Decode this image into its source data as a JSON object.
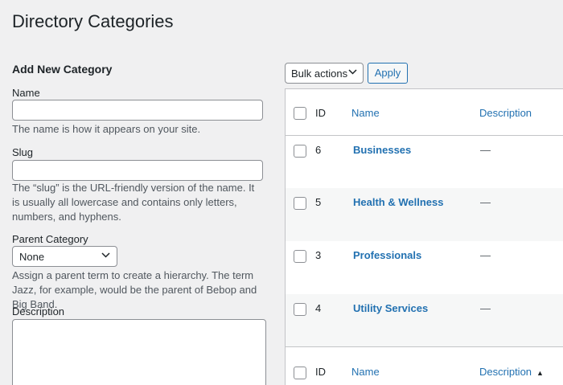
{
  "page": {
    "title": "Directory Categories"
  },
  "form": {
    "heading": "Add New Category",
    "name": {
      "label": "Name",
      "value": "",
      "help": "The name is how it appears on your site."
    },
    "slug": {
      "label": "Slug",
      "value": "",
      "help": "The “slug” is the URL-friendly version of the name. It is usually all lowercase and contains only letters, numbers, and hyphens."
    },
    "parent": {
      "label": "Parent Category",
      "selected": "None",
      "help": "Assign a parent term to create a hierarchy. The term Jazz, for example, would be the parent of Bebop and Big Band."
    },
    "description": {
      "label": "Description",
      "value": ""
    }
  },
  "toolbar": {
    "bulk_selected": "Bulk actions",
    "apply_label": "Apply"
  },
  "table": {
    "columns": {
      "id": "ID",
      "name": "Name",
      "description": "Description"
    },
    "rows": [
      {
        "id": "6",
        "name": "Businesses",
        "description": "—"
      },
      {
        "id": "5",
        "name": "Health & Wellness",
        "description": "—"
      },
      {
        "id": "3",
        "name": "Professionals",
        "description": "—"
      },
      {
        "id": "4",
        "name": "Utility Services",
        "description": "—"
      }
    ],
    "footer_sort_icon": "sort-ascending-icon"
  }
}
